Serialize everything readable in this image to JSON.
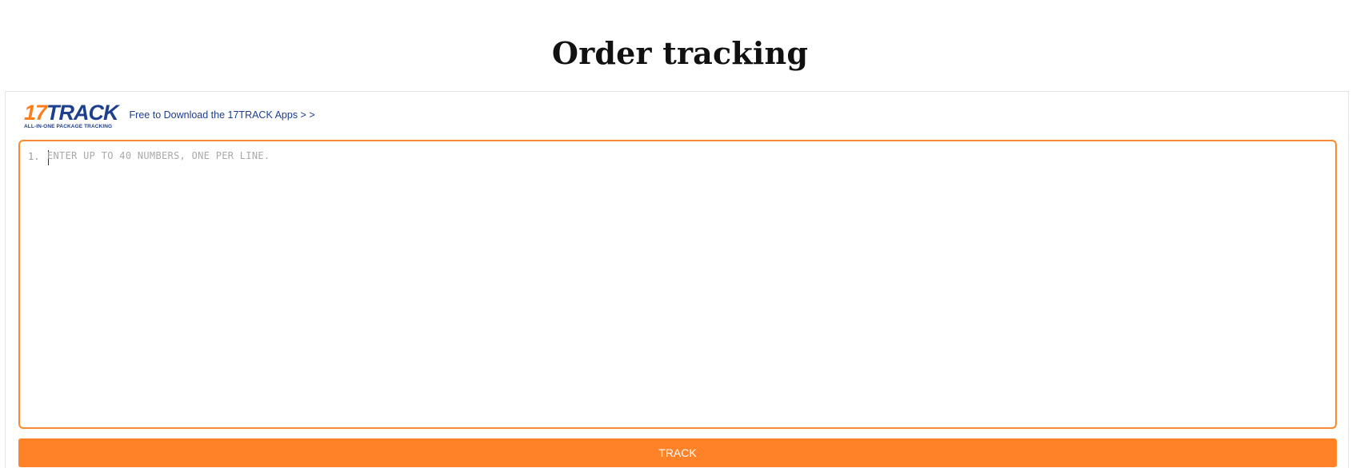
{
  "page": {
    "title": "Order tracking"
  },
  "widget": {
    "logo": {
      "number": "17",
      "word": "TRACK",
      "tagline": "ALL-IN-ONE PACKAGE TRACKING"
    },
    "download_link": "Free to Download the 17TRACK Apps > >",
    "input": {
      "line_number": "1.",
      "placeholder": "ENTER UP TO 40 NUMBERS, ONE PER LINE.",
      "value": ""
    },
    "button_label": "TRACK"
  },
  "colors": {
    "accent": "#ff8228",
    "brand_blue": "#1d3f8f"
  }
}
